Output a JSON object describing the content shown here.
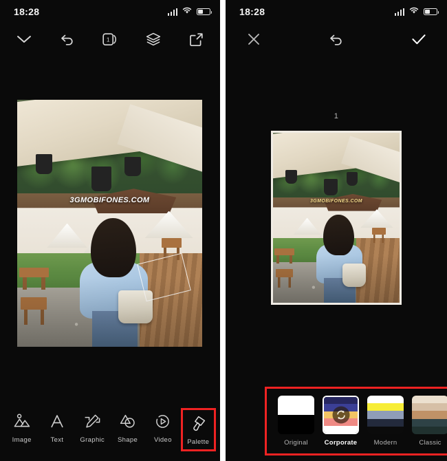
{
  "left_panel": {
    "status_bar": {
      "time": "18:28",
      "signal_icon": "cellular-signal-icon",
      "wifi_icon": "wifi-icon",
      "battery_icon": "battery-icon"
    },
    "top_bar": {
      "buttons": [
        {
          "name": "collapse-button",
          "icon": "chevron-down-icon"
        },
        {
          "name": "undo-button",
          "icon": "undo-arrow-icon"
        },
        {
          "name": "pages-button",
          "icon": "page-count-icon",
          "badge": "1"
        },
        {
          "name": "layers-button",
          "icon": "layers-icon"
        },
        {
          "name": "export-button",
          "icon": "share-export-icon"
        }
      ]
    },
    "canvas": {
      "watermark": "3GMOBIFONES.COM"
    },
    "toolbar": {
      "items": [
        {
          "label": "Image",
          "icon": "image-icon",
          "highlighted": false
        },
        {
          "label": "Text",
          "icon": "text-icon",
          "highlighted": false
        },
        {
          "label": "Graphic",
          "icon": "graphic-icon",
          "highlighted": false
        },
        {
          "label": "Shape",
          "icon": "shape-icon",
          "highlighted": false
        },
        {
          "label": "Video",
          "icon": "video-icon",
          "highlighted": false
        },
        {
          "label": "Palette",
          "icon": "palette-icon",
          "highlighted": true
        }
      ]
    }
  },
  "right_panel": {
    "status_bar": {
      "time": "18:28",
      "signal_icon": "cellular-signal-icon",
      "wifi_icon": "wifi-icon",
      "battery_icon": "battery-icon"
    },
    "top_bar": {
      "buttons": [
        {
          "name": "close-button",
          "icon": "close-x-icon"
        },
        {
          "name": "undo-button",
          "icon": "undo-arrow-icon"
        },
        {
          "name": "confirm-button",
          "icon": "check-icon"
        }
      ]
    },
    "canvas": {
      "slide_number": "1",
      "watermark": "3GMOBIFONES.COM"
    },
    "palette_picker": {
      "selected": "Corporate",
      "refresh_icon": "refresh-shuffle-icon",
      "items": [
        {
          "label": "Original",
          "selected": false,
          "colors": [
            "#ffffff",
            "#ffffff",
            "#000000",
            "#000000"
          ]
        },
        {
          "label": "Corporate",
          "selected": true,
          "colors": [
            "#27275f",
            "#3b3f96",
            "#f2c464",
            "#ef8a84",
            "#ffffff"
          ]
        },
        {
          "label": "Modern",
          "selected": false,
          "colors": [
            "#ffffff",
            "#f7ed37",
            "#8f9db8",
            "#232a3c",
            "#0b0b0b"
          ]
        },
        {
          "label": "Classic",
          "selected": false,
          "colors": [
            "#ece0cf",
            "#d6bfa6",
            "#c09267",
            "#2e4246",
            "#20312f"
          ]
        },
        {
          "label": "",
          "selected": false,
          "colors": [
            "#2f6b4a",
            "#c4b4e0",
            "#e8912b",
            "#1f3a52",
            "#132230"
          ]
        }
      ]
    },
    "highlight_color": "#ef2222"
  }
}
